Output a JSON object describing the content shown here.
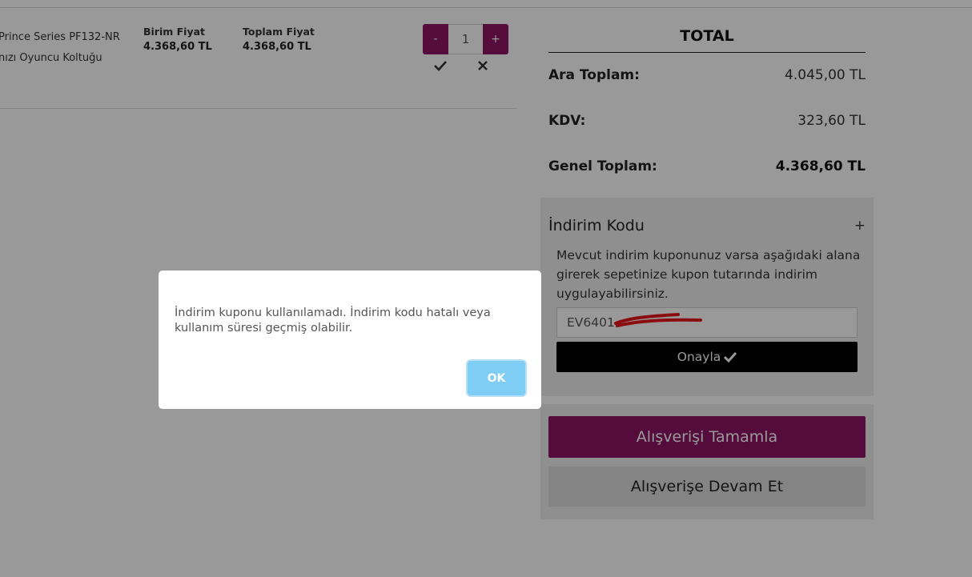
{
  "cart": {
    "product_line1": "Prince Series PF132-NR",
    "product_line2": "nızı Oyuncu Koltuğu",
    "unit_price_header": "Birim Fiyat",
    "unit_price": "4.368,60 TL",
    "total_price_header": "Toplam Fiyat",
    "total_price": "4.368,60 TL",
    "qty_minus": "-",
    "qty_value": "1",
    "qty_plus": "+",
    "confirm_icon": "check-icon",
    "remove_icon": "close-icon"
  },
  "summary": {
    "title": "TOTAL",
    "subtotal_label": "Ara Toplam:",
    "subtotal_value": "4.045,00 TL",
    "tax_label": "KDV:",
    "tax_value": "323,60 TL",
    "grand_label": "Genel Toplam:",
    "grand_value": "4.368,60 TL"
  },
  "coupon": {
    "title": "İndirim Kodu",
    "toggle": "+",
    "description": "Mevcut indirim kuponunuz varsa aşağıdaki alana girerek sepetinize kupon tutarında indirim uygulayabilirsiniz.",
    "input_value": "EV6401",
    "approve_label": "Onayla"
  },
  "actions": {
    "checkout_label": "Alışverişi Tamamla",
    "continue_label": "Alışverişe Devam Et"
  },
  "modal": {
    "message": "İndirim kuponu kullanılamadı. İndirim kodu hatalı veya kullanım süresi geçmiş olabilir.",
    "ok_label": "OK"
  },
  "colors": {
    "brand": "#8e1466",
    "ok_button": "#7ecdf4",
    "redaction": "#e8141a"
  }
}
